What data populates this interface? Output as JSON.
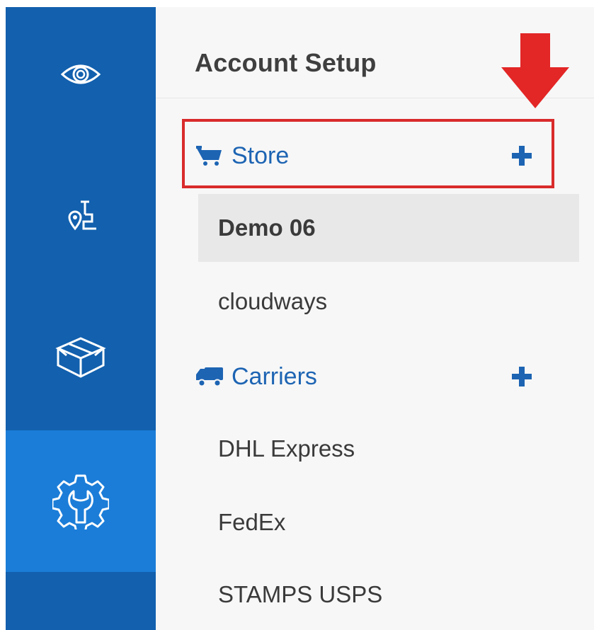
{
  "rail": {
    "items": [
      {
        "icon": "eye-icon",
        "active": false
      },
      {
        "icon": "route-pin-icon",
        "active": false
      },
      {
        "icon": "package-box-icon",
        "active": false
      },
      {
        "icon": "settings-wrench-gear-icon",
        "active": true
      }
    ],
    "colors": {
      "background": "#1260ae",
      "active": "#1b7dd8"
    }
  },
  "panel": {
    "title": "Account Setup",
    "annotation_arrow_color": "#e32626",
    "highlight_box_color": "#d92b2b",
    "sections": [
      {
        "label": "Store",
        "icon": "cart-icon",
        "add_icon": "plus-icon",
        "items": [
          {
            "label": "Demo 06",
            "selected": true
          },
          {
            "label": "cloudways",
            "selected": false
          }
        ]
      },
      {
        "label": "Carriers",
        "icon": "truck-icon",
        "add_icon": "plus-icon",
        "items": [
          {
            "label": "DHL Express",
            "selected": false
          },
          {
            "label": "FedEx",
            "selected": false
          },
          {
            "label": "STAMPS USPS",
            "selected": false
          }
        ]
      }
    ],
    "accent_color": "#1d64b3"
  }
}
